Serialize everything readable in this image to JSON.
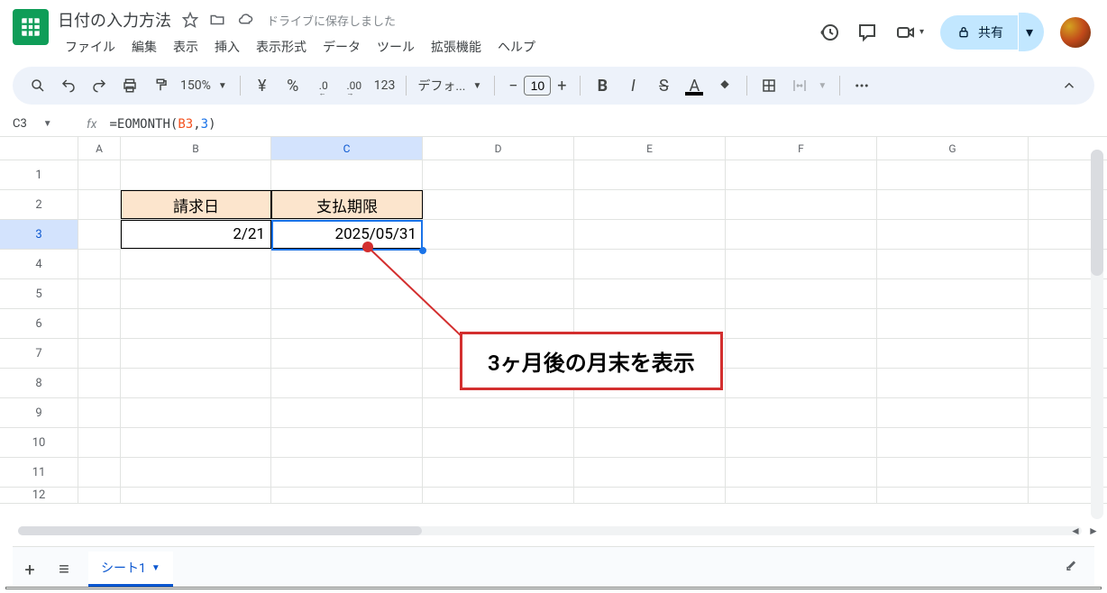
{
  "doc": {
    "title": "日付の入力方法",
    "save_status": "ドライブに保存しました"
  },
  "menu": {
    "file": "ファイル",
    "edit": "編集",
    "view": "表示",
    "insert": "挿入",
    "format": "表示形式",
    "data": "データ",
    "tools": "ツール",
    "extensions": "拡張機能",
    "help": "ヘルプ"
  },
  "toolbar": {
    "zoom": "150%",
    "currency": "¥",
    "percent": "%",
    "dec_dec": ".0",
    "inc_dec": ".00",
    "num_fmt": "123",
    "font": "デフォ...",
    "font_size": "10",
    "bold": "B",
    "italic": "I",
    "strike": "S",
    "text_color": "A"
  },
  "share": {
    "label": "共有"
  },
  "name_box": "C3",
  "formula": {
    "prefix": "=EOMONTH(",
    "ref": "B3",
    "comma": ",",
    "num": "3",
    "suffix": ")"
  },
  "columns": [
    "A",
    "B",
    "C",
    "D",
    "E",
    "F",
    "G"
  ],
  "rows": [
    "1",
    "2",
    "3",
    "4",
    "5",
    "6",
    "7",
    "8",
    "9",
    "10",
    "11",
    "12"
  ],
  "cells": {
    "B2": "請求日",
    "C2": "支払期限",
    "B3": "2/21",
    "C3": "2025/05/31"
  },
  "annotation": "3ヶ月後の月末を表示",
  "sheet": {
    "tab1": "シート1"
  }
}
